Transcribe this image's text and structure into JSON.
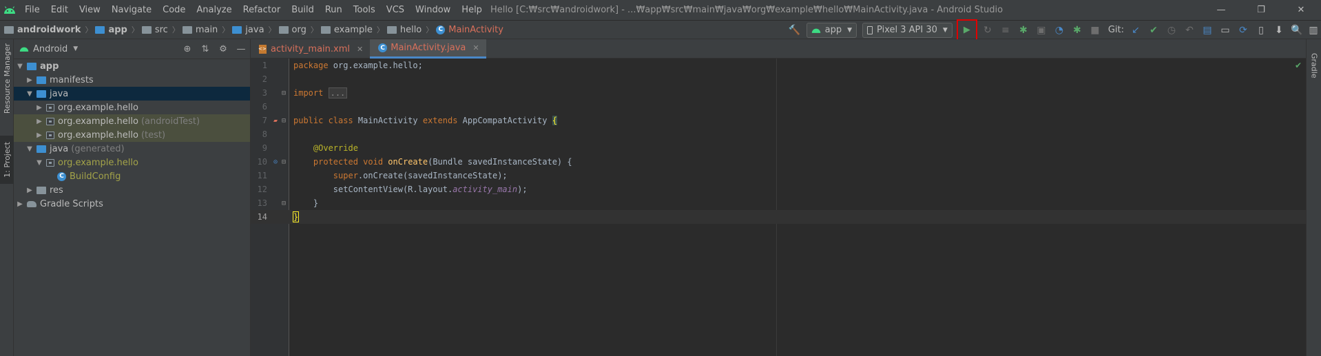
{
  "menubar": {
    "items": [
      "File",
      "Edit",
      "View",
      "Navigate",
      "Code",
      "Analyze",
      "Refactor",
      "Build",
      "Run",
      "Tools",
      "VCS",
      "Window",
      "Help"
    ],
    "title": "Hello [C:₩src₩androidwork] - ...₩app₩src₩main₩java₩org₩example₩hello₩MainActivity.java - Android Studio",
    "window_controls": [
      "—",
      "❐",
      "✕"
    ]
  },
  "breadcrumb": {
    "items": [
      "androidwork",
      "app",
      "src",
      "main",
      "java",
      "org",
      "example",
      "hello",
      "MainActivity"
    ]
  },
  "toolbar": {
    "run_config": "app",
    "device": "Pixel 3 API 30",
    "git_label": "Git:",
    "icons": [
      "hammer-icon",
      "run-icon",
      "apply-changes-icon",
      "apply-code-changes-icon",
      "debug-icon",
      "attach-debugger-icon",
      "profile-icon",
      "attach-debugger-process-icon",
      "stop-icon",
      "git-update-icon",
      "git-commit-icon",
      "git-history-icon",
      "git-rollback-icon",
      "project-structure-icon",
      "sync-gradle-icon",
      "avd-manager-icon",
      "sdk-manager-icon",
      "search-icon"
    ]
  },
  "left_strip": {
    "resource_manager": "Resource Manager",
    "project": "1: Project"
  },
  "right_strip": {
    "gradle": "Gradle"
  },
  "project_panel": {
    "view_mode": "Android",
    "tree": [
      {
        "label": "app",
        "bold": true
      },
      {
        "label": "manifests"
      },
      {
        "label": "java"
      },
      {
        "label": "org.example.hello"
      },
      {
        "label": "org.example.hello",
        "suffix": "(androidTest)"
      },
      {
        "label": "org.example.hello",
        "suffix": "(test)"
      },
      {
        "label": "java",
        "suffix": "(generated)"
      },
      {
        "label": "org.example.hello"
      },
      {
        "label": "BuildConfig"
      },
      {
        "label": "res"
      },
      {
        "label": "Gradle Scripts"
      }
    ]
  },
  "editor": {
    "tabs": [
      {
        "label": "activity_main.xml",
        "close": "✕"
      },
      {
        "label": "MainActivity.java",
        "close": "✕"
      }
    ],
    "line_numbers": [
      "1",
      "2",
      "3",
      "6",
      "7",
      "8",
      "9",
      "10",
      "11",
      "12",
      "13",
      "14"
    ],
    "code": {
      "l1_kw": "package",
      "l1_rest": " org.example.hello;",
      "l3_kw": "import",
      "l3_fold": "...",
      "l7_kw": "public class",
      "l7_name": " MainActivity ",
      "l7_ext": "extends",
      "l7_rest": " AppCompatActivity ",
      "l7_brace": "{",
      "l9_ann": "@Override",
      "l10_kw": "protected void",
      "l10_fn": "onCreate",
      "l10_rest": "(Bundle savedInstanceState) {",
      "l11_kw": "super",
      "l11_rest": ".onCreate(savedInstanceState);",
      "l12_pre": "setContentView(R.layout.",
      "l12_it": "activity_main",
      "l12_post": ");",
      "l13": "}",
      "l14": "}"
    }
  },
  "colors": {
    "run_highlight": "#e00000",
    "android_green": "#3ddc84",
    "run_green": "#59a869"
  }
}
